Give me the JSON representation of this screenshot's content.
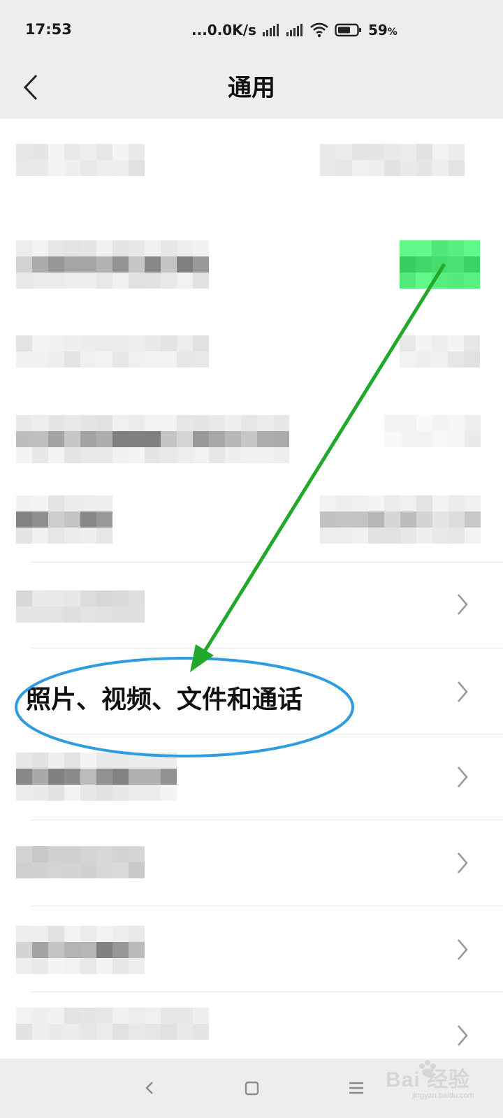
{
  "status_bar": {
    "time": "17:53",
    "network_speed": "...0.0K/s",
    "battery_percent": "59",
    "battery_unit": "%",
    "icons": [
      "signal-icon",
      "signal-icon",
      "wifi-icon",
      "battery-icon"
    ]
  },
  "header": {
    "title": "通用",
    "back_icon": "chevron-left-icon"
  },
  "list": {
    "highlighted_item_label": "照片、视频、文件和通话",
    "chevron_icon": "chevron-right-icon",
    "accent_color": "#07c160"
  },
  "annotation": {
    "arrow_color": "#22a82a",
    "ellipse_color": "#2f9be0"
  },
  "nav_bar": {
    "icons": [
      "back-triangle-icon",
      "home-square-icon",
      "menu-lines-icon"
    ]
  },
  "watermark": {
    "brand": "Bai  经验",
    "url": "jingyan.baidu.com"
  }
}
